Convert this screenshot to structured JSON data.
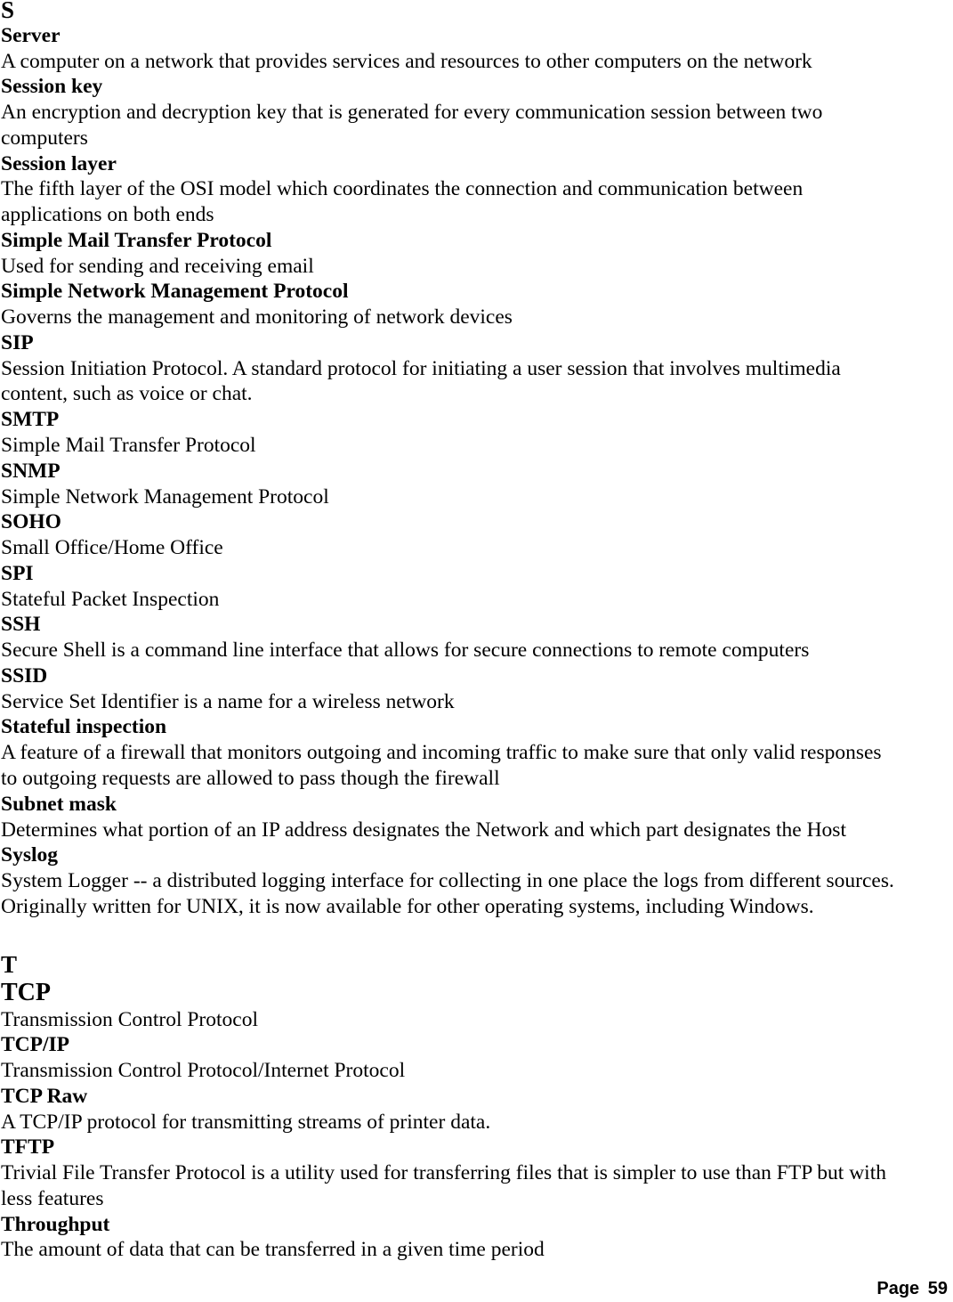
{
  "sections": [
    {
      "letter": "S",
      "entries": [
        {
          "term": "Server",
          "desc": [
            "A computer on a network that provides services and resources to other computers on the network"
          ]
        },
        {
          "term": "Session key",
          "desc": [
            "An encryption and decryption key that is generated for every communication session between two",
            "computers"
          ]
        },
        {
          "term": "Session layer",
          "desc": [
            "The fifth layer of the OSI model which coordinates the connection and communication between",
            "applications on both ends"
          ]
        },
        {
          "term": "Simple Mail Transfer Protocol",
          "desc": [
            "Used for sending and receiving email"
          ]
        },
        {
          "term": "Simple Network Management Protocol",
          "desc": [
            "Governs the management and monitoring of network devices"
          ]
        },
        {
          "term": "SIP",
          "desc": [
            "Session Initiation Protocol. A standard protocol for initiating a user session that involves multimedia",
            "content, such as voice or chat."
          ]
        },
        {
          "term": "SMTP",
          "desc": [
            "Simple Mail Transfer Protocol"
          ]
        },
        {
          "term": "SNMP",
          "desc": [
            "Simple Network Management Protocol"
          ]
        },
        {
          "term": "SOHO",
          "desc": [
            "Small Office/Home Office"
          ]
        },
        {
          "term": "SPI",
          "desc": [
            "Stateful Packet Inspection"
          ]
        },
        {
          "term": "SSH",
          "desc": [
            "Secure Shell is a command line interface that allows for secure connections to remote computers"
          ]
        },
        {
          "term": "SSID",
          "desc": [
            "Service Set Identifier is a name for a wireless network"
          ]
        },
        {
          "term": "Stateful inspection",
          "desc": [
            "A feature of a firewall that monitors outgoing and incoming traffic to make sure that only valid responses",
            "to outgoing requests are allowed to pass though the firewall"
          ]
        },
        {
          "term": "Subnet mask",
          "desc": [
            "Determines what portion of an IP address designates the Network and which part designates the Host"
          ]
        },
        {
          "term": "Syslog",
          "desc": [
            "System Logger -- a distributed logging interface for collecting in one place the logs from different sources.",
            "Originally written for UNIX, it is now available for other operating systems, including Windows."
          ]
        }
      ]
    },
    {
      "letter": "T",
      "entries": [
        {
          "term": "TCP",
          "big": true,
          "desc": [
            "Transmission Control Protocol"
          ]
        },
        {
          "term": "TCP/IP",
          "desc": [
            "Transmission Control Protocol/Internet Protocol"
          ]
        },
        {
          "term": "TCP Raw",
          "desc": [
            "A TCP/IP protocol for transmitting streams of printer data."
          ]
        },
        {
          "term": "TFTP",
          "desc": [
            "Trivial File Transfer Protocol is a utility used for transferring files that is simpler to use than FTP but with",
            "less features"
          ]
        },
        {
          "term": "Throughput",
          "desc": [
            "The amount of data that can be transferred in a given time period"
          ]
        }
      ]
    }
  ],
  "footer": {
    "page_label": "Page",
    "page_number": "59"
  }
}
